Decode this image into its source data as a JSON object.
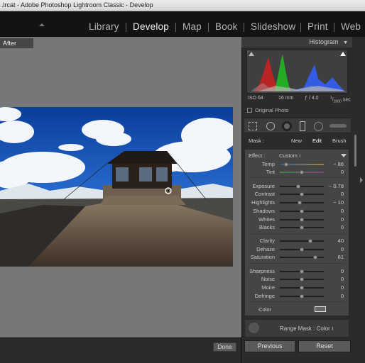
{
  "window": {
    "title": ".lrcat - Adobe Photoshop Lightroom Classic - Develop"
  },
  "modules": [
    {
      "label": "Library",
      "active": false
    },
    {
      "label": "Develop",
      "active": true
    },
    {
      "label": "Map",
      "active": false
    },
    {
      "label": "Book",
      "active": false
    },
    {
      "label": "Slideshow",
      "active": false
    },
    {
      "label": "Print",
      "active": false
    },
    {
      "label": "Web",
      "active": false
    }
  ],
  "viewer": {
    "after_label": "After",
    "done_label": "Done"
  },
  "histogram": {
    "title": "Histogram",
    "iso": "ISO 64",
    "focal": "16 mm",
    "aperture": "ƒ / 4.0",
    "shutter_num": "1",
    "shutter_den": "2000",
    "shutter_unit": "sec",
    "original_photo": "Original Photo"
  },
  "mask": {
    "label": "Mask :",
    "new": "New",
    "edit": "Edit",
    "brush": "Brush"
  },
  "effect": {
    "label": "Effect :",
    "preset": "Custom ≀"
  },
  "sliders": [
    {
      "label": "Temp",
      "value": "− 86",
      "pos": 0.14
    },
    {
      "label": "Tint",
      "value": "0",
      "pos": 0.5
    },
    {
      "label": "Exposure",
      "value": "− 0.78",
      "pos": 0.42
    },
    {
      "label": "Contrast",
      "value": "0",
      "pos": 0.5
    },
    {
      "label": "Highlights",
      "value": "− 10",
      "pos": 0.45
    },
    {
      "label": "Shadows",
      "value": "0",
      "pos": 0.5
    },
    {
      "label": "Whites",
      "value": "0",
      "pos": 0.5
    },
    {
      "label": "Blacks",
      "value": "0",
      "pos": 0.5
    },
    {
      "label": "Clarity",
      "value": "40",
      "pos": 0.7
    },
    {
      "label": "Dehaze",
      "value": "0",
      "pos": 0.5
    },
    {
      "label": "Saturation",
      "value": "61",
      "pos": 0.8
    },
    {
      "label": "Sharpness",
      "value": "0",
      "pos": 0.5
    },
    {
      "label": "Noise",
      "value": "0",
      "pos": 0.5
    },
    {
      "label": "Moire",
      "value": "0",
      "pos": 0.5
    },
    {
      "label": "Defringe",
      "value": "0",
      "pos": 0.5
    }
  ],
  "color": {
    "label": "Color"
  },
  "range_mask": {
    "label": "Range Mask :",
    "value": "Color ≀"
  },
  "buttons": {
    "previous": "Previous",
    "reset": "Reset"
  },
  "colors": {
    "accent": "#f2f2f2",
    "panel": "#454545"
  }
}
